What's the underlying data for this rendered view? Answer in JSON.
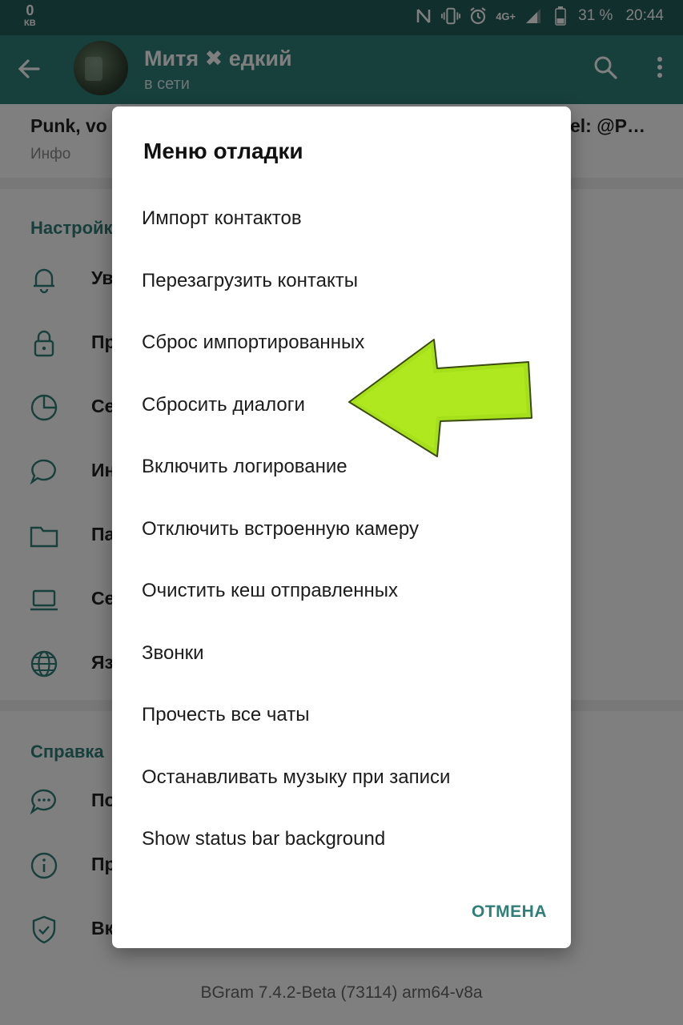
{
  "status_bar": {
    "speed_value": "0",
    "speed_unit": "КВ",
    "network": "4G+",
    "battery": "31 %",
    "time": "20:44"
  },
  "header": {
    "chat_name": "Митя ✖ едкий",
    "status": "в сети"
  },
  "profile": {
    "bio_left": "Punk, vo",
    "bio_right": "el: @P…",
    "bio_label": "Инфо"
  },
  "settings": {
    "section_title": "Настройк",
    "items": [
      {
        "label": "Ув",
        "icon": "bell-icon"
      },
      {
        "label": "Пр",
        "icon": "lock-icon"
      },
      {
        "label": "Се",
        "icon": "pie-chart-icon"
      },
      {
        "label": "Ин",
        "icon": "chat-bubble-icon"
      },
      {
        "label": "Па",
        "icon": "folder-icon"
      },
      {
        "label": "Се",
        "icon": "laptop-icon"
      },
      {
        "label": "Яз",
        "icon": "globe-icon"
      }
    ]
  },
  "help": {
    "section_title": "Справка",
    "items": [
      {
        "label": "По",
        "icon": "chat-dots-icon"
      },
      {
        "label": "Пр",
        "icon": "info-icon"
      },
      {
        "label": "Вк",
        "icon": "shield-check-icon"
      }
    ]
  },
  "footer": {
    "version": "BGram 7.4.2-Beta (73114) arm64-v8a"
  },
  "dialog": {
    "title": "Меню отладки",
    "items": [
      "Импорт контактов",
      "Перезагрузить контакты",
      "Сброс импортированных",
      "Сбросить диалоги",
      "Включить логирование",
      "Отключить встроенную камеру",
      "Очистить кеш отправленных",
      "Звонки",
      "Прочесть все чаты",
      "Останавливать музыку при записи",
      "Show status bar background"
    ],
    "cancel_label": "ОТМЕНА"
  },
  "colors": {
    "status_bar": "#225f59",
    "app_bar": "#2f7f78",
    "accent": "#2f7f78",
    "arrow": "#a6e01a"
  }
}
